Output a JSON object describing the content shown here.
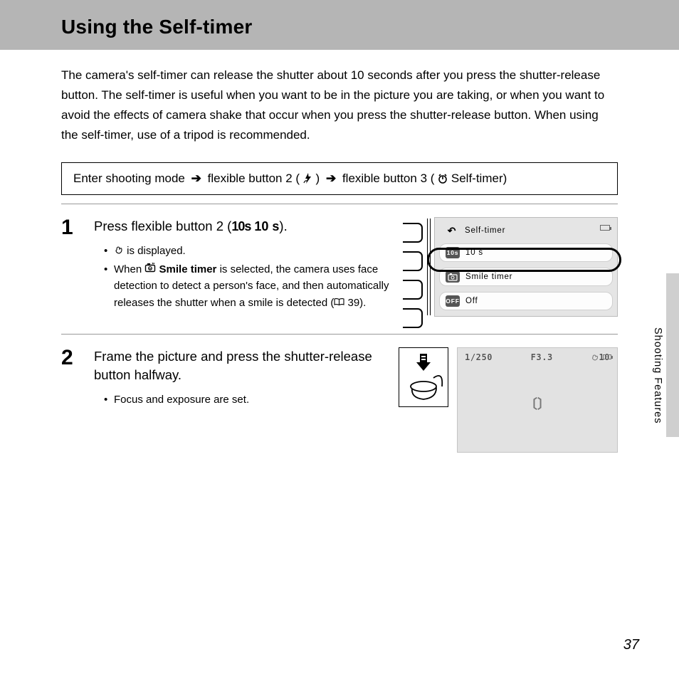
{
  "title": "Using the Self-timer",
  "intro": "The camera's self-timer can release the shutter about 10 seconds after you press the shutter-release button. The self-timer is useful when you want to be in the picture you are taking, or when you want to avoid the effects of camera shake that occur when you press the shutter-release button. When using the self-timer, use of a tripod is recommended.",
  "nav": {
    "a": "Enter shooting mode",
    "b": "flexible button 2 (",
    "b_icon": "flash-timer-icon",
    "b2": ")",
    "c": "flexible button 3 (",
    "c_icon": "self-timer-icon",
    "c2": " Self-timer)"
  },
  "steps": [
    {
      "num": "1",
      "title_pre": "Press flexible button 2 (",
      "title_icon": "10s",
      "title_bold": " 10 s",
      "title_post": ").",
      "bullets": [
        {
          "icon": "hand-icon",
          "text": " is displayed."
        },
        {
          "pre": "When ",
          "icon": "smile-timer-icon",
          "bold": " Smile timer",
          "post": " is selected, the camera uses face detection to detect a person's face, and then automatically releases the shutter when a smile is detected (",
          "ref_icon": "book-icon",
          "ref": " 39)."
        }
      ],
      "menu": {
        "header": "Self-timer",
        "options": [
          {
            "icon": "10s",
            "label": "10 s",
            "selected": true
          },
          {
            "icon": "smile",
            "label": "Smile timer",
            "selected": false
          },
          {
            "icon": "OFF",
            "label": "Off",
            "selected": false
          }
        ]
      }
    },
    {
      "num": "2",
      "title": "Frame the picture and press the shutter-release button halfway.",
      "bullets_plain": [
        "Focus and exposure are set."
      ],
      "lcd": {
        "shutter": "1/250",
        "aperture": "F3.3",
        "timer": "10",
        "timer_icon": "hand-icon"
      }
    }
  ],
  "side_label": "Shooting Features",
  "page_number": "37"
}
